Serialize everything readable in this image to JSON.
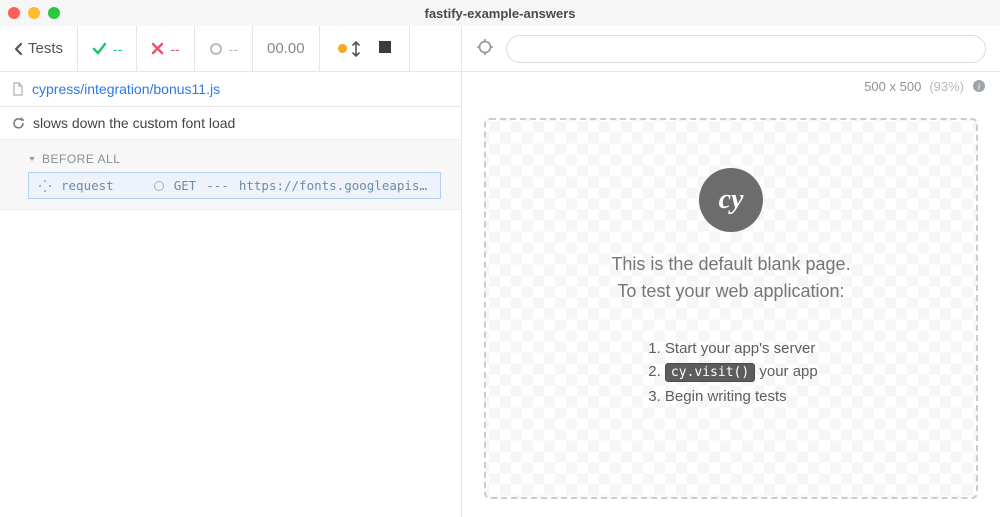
{
  "window": {
    "title": "fastify-example-answers"
  },
  "runner": {
    "back_label": "Tests",
    "stats": {
      "pass": "--",
      "fail": "--",
      "pending": "--"
    },
    "duration": "00.00",
    "filepath": "cypress/integration/bonus11.js"
  },
  "test": {
    "title": "slows down the custom font load",
    "hook": "BEFORE ALL",
    "command": {
      "name": "request",
      "method": "GET",
      "dash": "---",
      "url": "https://fonts.googleapis…"
    }
  },
  "viewport": {
    "size": "500 x 500",
    "scale": "(93%)"
  },
  "blank_page": {
    "line1": "This is the default blank page.",
    "line2": "To test your web application:",
    "steps": {
      "s1": "Start your app's server",
      "s2_code": "cy.visit()",
      "s2_rest": " your app",
      "s3": "Begin writing tests"
    },
    "logo_text": "cy"
  }
}
